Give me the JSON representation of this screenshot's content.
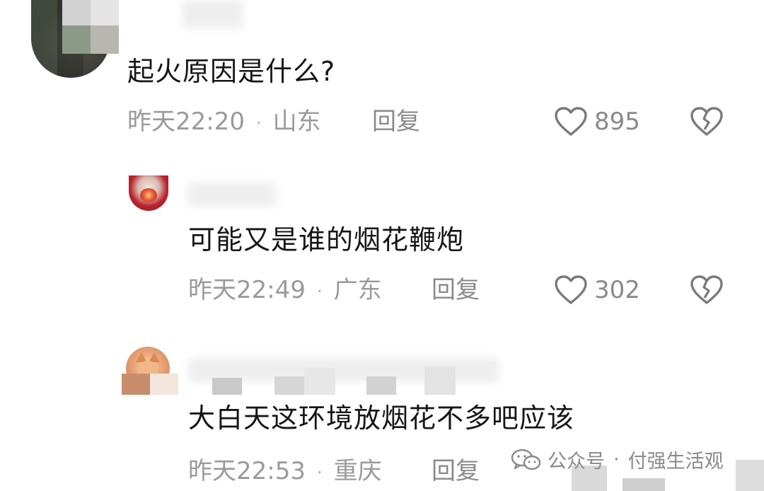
{
  "comments": [
    {
      "text": "起火原因是什么?",
      "time": "昨天22:20",
      "location": "山东",
      "reply_label": "回复",
      "likes": "895"
    },
    {
      "text": "可能又是谁的烟花鞭炮",
      "time": "昨天22:49",
      "location": "广东",
      "reply_label": "回复",
      "likes": "302"
    },
    {
      "text": "大白天这环境放烟花不多吧应该",
      "time": "昨天22:53",
      "location": "重庆",
      "reply_label": "回复"
    }
  ],
  "separator": "·",
  "watermark": {
    "source": "公众号",
    "separator": "·",
    "account": "付强生活观"
  },
  "icons": {
    "like": "heart-outline-icon",
    "dislike": "broken-heart-icon",
    "watermark": "wechat-icon"
  },
  "colors": {
    "text": "#161616",
    "meta": "#9a9a9a",
    "icon": "#7a7a7a"
  }
}
